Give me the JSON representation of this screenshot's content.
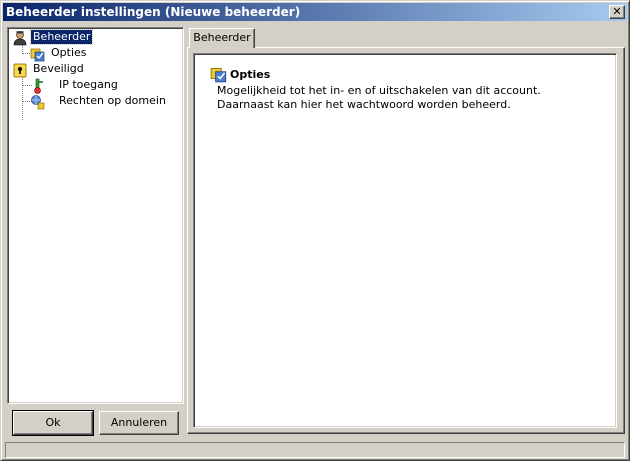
{
  "window": {
    "title": "Beheerder instellingen (Nieuwe beheerder)",
    "close_glyph": "✕"
  },
  "tree": {
    "items": [
      {
        "label": "Beheerder",
        "icon": "user-icon",
        "selected": true
      },
      {
        "label": "Opties",
        "icon": "options-icon"
      },
      {
        "label": "Beveiligd",
        "icon": "lock-icon"
      },
      {
        "label": "IP toegang",
        "icon": "network-key-icon"
      },
      {
        "label": "Rechten op domein",
        "icon": "domain-rights-icon"
      }
    ]
  },
  "buttons": {
    "ok": "Ok",
    "cancel": "Annuleren"
  },
  "tabs": [
    {
      "label": "Beheerder",
      "active": true
    }
  ],
  "content": {
    "heading": "Opties",
    "heading_icon": "options-icon",
    "description": "Mogelijkheid tot het in- en of uitschakelen van dit account. Daarnaast kan hier het wachtwoord worden beheerd."
  },
  "colors": {
    "titlebar_start": "#0a246a",
    "titlebar_end": "#a6caf0",
    "selection": "#0a246a",
    "face": "#d4d0c8"
  }
}
